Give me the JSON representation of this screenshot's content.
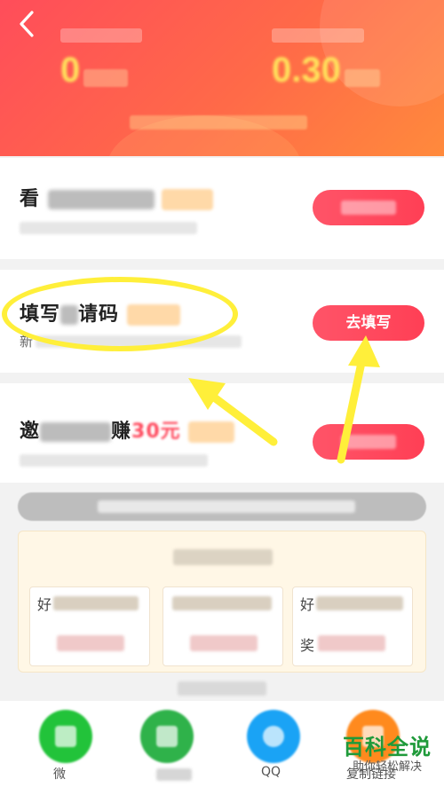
{
  "header": {
    "back_glyph": "‹",
    "left_stat": {
      "value": "0"
    },
    "right_stat": {
      "value": "0.30"
    }
  },
  "tasks": [
    {
      "title_prefix": "看",
      "desc": "",
      "button_label": ""
    },
    {
      "title_prefix": "填写",
      "title_suffix": "请码",
      "desc_prefix": "新",
      "button_label": "去填写"
    },
    {
      "title_prefix": "邀",
      "title_suffix": "赚",
      "highlight_text": "30元",
      "button_label": ""
    }
  ],
  "reward_panel": {
    "columns": [
      {
        "top_prefix": "好",
        "bottom_prefix": ""
      },
      {
        "top_prefix": "",
        "bottom_prefix": ""
      },
      {
        "top_prefix": "好",
        "bottom_prefix": "奖"
      }
    ]
  },
  "share": {
    "items": [
      {
        "name": "wechat",
        "caption": "微",
        "color": "#22c33a"
      },
      {
        "name": "moments",
        "caption": "",
        "color": "#2fb24a"
      },
      {
        "name": "qq",
        "caption": "QQ",
        "color": "#1aa3f5"
      },
      {
        "name": "copy-link",
        "caption": "复制链接",
        "color": "#ff8a1e"
      }
    ]
  },
  "watermark": {
    "title": "百科全说",
    "subtitle": "助你轻松解决"
  },
  "colors": {
    "header_start": "#ff4d5a",
    "button": "#ff4a5e",
    "highlight": "#ffef3a"
  }
}
